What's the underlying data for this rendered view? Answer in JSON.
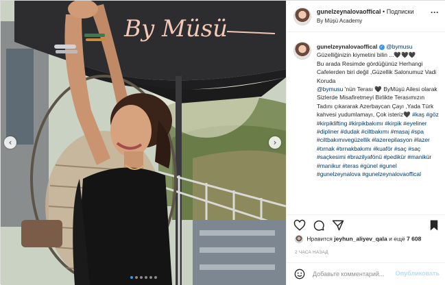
{
  "photo": {
    "sign_text": "By Müsü",
    "carousel_dots": 6,
    "active_dot": 0,
    "prev_icon": "chevron-left-icon",
    "next_icon": "chevron-right-icon"
  },
  "header": {
    "username": "gunelzeynalovaoffical",
    "separator": "•",
    "follow_label": "Подписки",
    "location": "By Müşü Academy",
    "more_icon": "ellipsis-icon"
  },
  "caption": {
    "author": "gunelzeynalovaoffical",
    "mention_tag": "@bymusu",
    "body_1": "Güzelliğinizin kiymetini bilin ...🖤🖤🖤",
    "body_2": "Bu arada Resimde gördüğünüz Herhangi Cafelerden biri değil ,Güzellik Salonumuz Vadi Koruda",
    "mention_2": "@bymusu",
    "body_3": "'nün Terası 🖤 ByMüşü Ailesi olarak Sizlerde Misafiretmeyi Birlikte Terasımızın Tadını çıkararak Azerbaycan Çayı ,Yada Türk kahvesi yudumlamayı, Çok isteriz🖤",
    "hashtags": "#kaş #göz #kirpiklifting #kirpikbakımı #kirpik #eyeliner #dipliner #dudak #ciltbakımı #masaj #spa #ciltbakımıvegüzellik #lazerepilasyon #lazer #tırnak #tırnakbakımı #kuaför #saç #saç #saçkesimi #brazilyafönü #pedikür #manikür #manikur #teras #günel #gunel #gunelzeynalova #gunelzeynalovaoffical"
  },
  "actions": {
    "like_icon": "heart-icon",
    "comment_icon": "comment-icon",
    "share_icon": "paper-plane-icon",
    "save_icon": "bookmark-icon"
  },
  "likes": {
    "prefix": "Нравится",
    "user": "jeyhun_aliyev_qala",
    "middle": "и ещё",
    "count": "7 608"
  },
  "time_ago": "2 ЧАСА НАЗАД",
  "comment": {
    "placeholder": "Добавьте комментарий...",
    "publish_label": "Опубликовать",
    "emoji_icon": "smiley-icon"
  },
  "colors": {
    "link": "#00376b",
    "hashtag": "#00376b",
    "verified": "#3897f0",
    "publish_disabled": "#b2dffc",
    "muted": "#8e8e8e"
  }
}
